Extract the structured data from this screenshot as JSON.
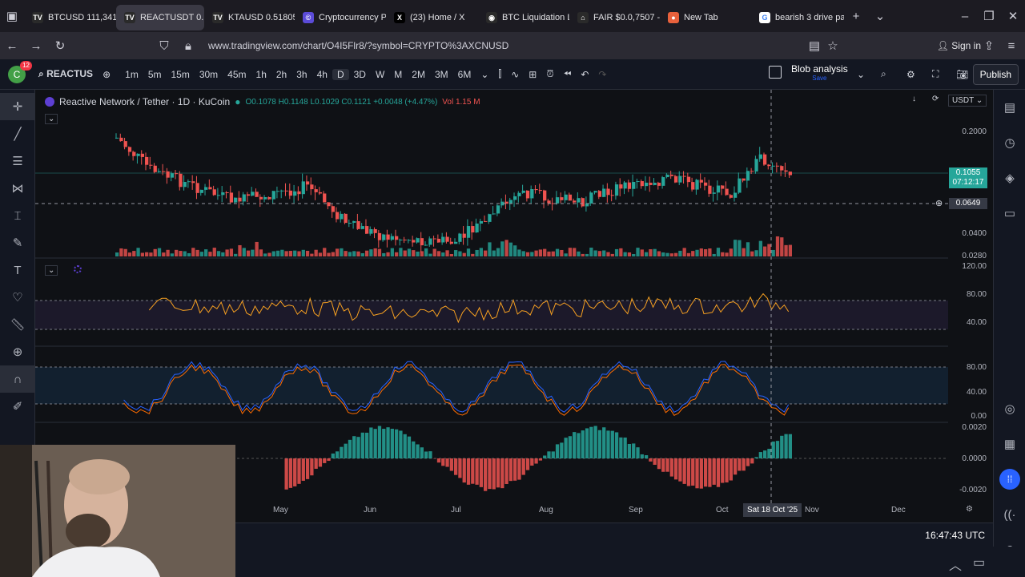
{
  "browser": {
    "tabs": [
      {
        "label": "BTCUSD 111,341.",
        "active": false
      },
      {
        "label": "REACTUSDT 0.",
        "active": true
      },
      {
        "label": "KTAUSD 0.51805",
        "active": false
      },
      {
        "label": "Cryptocurrency Pr",
        "active": false
      },
      {
        "label": "(23) Home / X",
        "active": false
      },
      {
        "label": "BTC Liquidation L",
        "active": false
      },
      {
        "label": "FAIR $0.0,7507 -",
        "active": false
      },
      {
        "label": "New Tab",
        "active": false
      },
      {
        "label": "bearish 3 drive pa",
        "active": false
      }
    ],
    "url": "www.tradingview.com/chart/O4I5Flr8/?symbol=CRYPTO%3AXCNUSD",
    "sign_in": "Sign in"
  },
  "toolbar": {
    "avatar": "C",
    "notif_count": "12",
    "symbol": "REACTUS",
    "intervals": [
      "1m",
      "5m",
      "15m",
      "30m",
      "45m",
      "1h",
      "2h",
      "3h",
      "4h",
      "D",
      "3D",
      "W",
      "M",
      "2M",
      "3M",
      "6M"
    ],
    "selected_interval": "D",
    "blob_label": "Blob analysis",
    "blob_sub": "Save",
    "publish": "Publish"
  },
  "legend": {
    "title": "Reactive Network / Tether · 1D · KuCoin",
    "ohlc": "O0.1078  H0.1148  L0.1029  C0.1121  +0.0048 (+4.47%)",
    "vol": "Vol 1.15 M"
  },
  "price_scale": {
    "currency": "USDT",
    "labels": [
      "0.2000",
      "0.0400",
      "0.0280"
    ],
    "last_price": "0.1055",
    "countdown": "07:12:17",
    "crosshair_price": "0.0649"
  },
  "indicator_scales": {
    "rsi": [
      "120.00",
      "80.00",
      "40.00"
    ],
    "stoch": [
      "80.00",
      "40.00",
      "0.00"
    ],
    "macd": [
      "0.0020",
      "0.0000",
      "-0.0020"
    ]
  },
  "time_axis": {
    "labels": [
      "May",
      "Jun",
      "Jul",
      "Aug",
      "Sep",
      "Oct",
      "Nov",
      "Dec"
    ],
    "crosshair": "Sat 18 Oct '25"
  },
  "clock": "16:47:43 UTC",
  "colors": {
    "up": "#26a69a",
    "down": "#ef5350",
    "rsi": "#f6a021",
    "stoch_k": "#2962ff",
    "stoch_d": "#ff6d00",
    "bg": "#0f1115"
  }
}
